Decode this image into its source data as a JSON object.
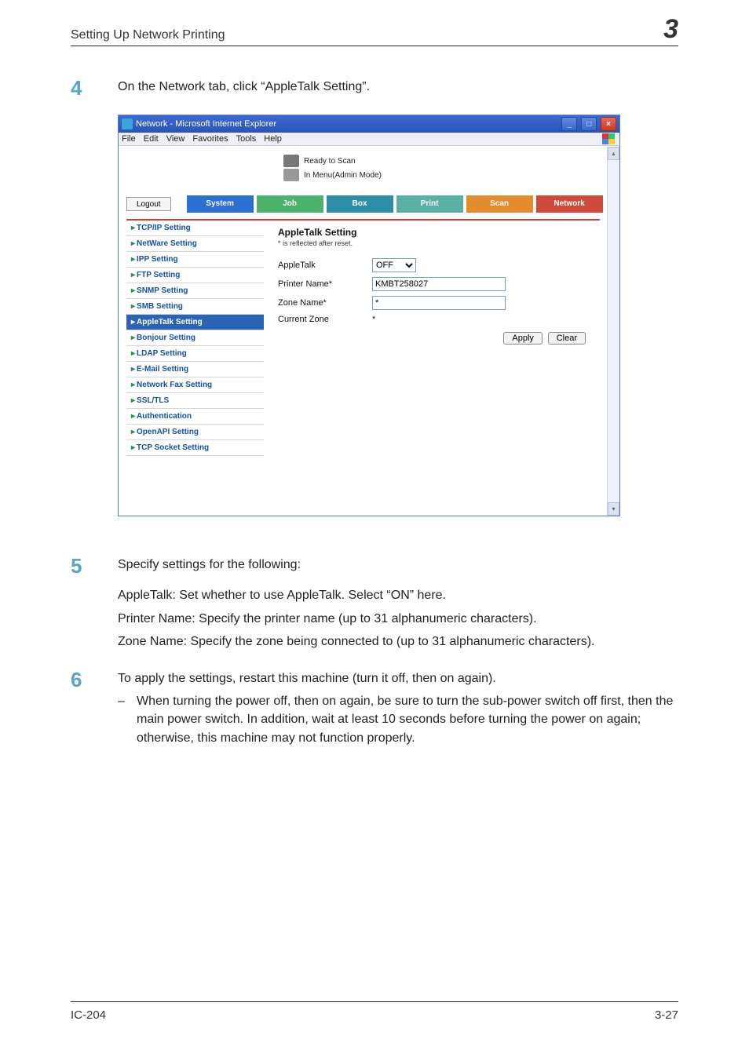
{
  "header": {
    "section_title": "Setting Up Network Printing",
    "chapter_num": "3"
  },
  "steps": {
    "s4": {
      "num": "4",
      "text": "On the Network tab, click “AppleTalk Setting”."
    },
    "s5": {
      "num": "5",
      "lead": "Specify settings for the following:",
      "p1": "AppleTalk: Set whether to use AppleTalk. Select “ON” here.",
      "p2": "Printer Name: Specify the printer name (up to 31 alphanumeric characters).",
      "p3": "Zone Name: Specify the zone being connected to (up to 31 alphanumeric characters)."
    },
    "s6": {
      "num": "6",
      "lead": "To apply the settings, restart this machine (turn it off, then on again).",
      "bullet1": "When turning the power off, then on again, be sure to turn the sub-power switch off first, then the main power switch. In addition, wait at least 10 seconds before turning the power on again; otherwise, this machine may not function properly."
    }
  },
  "window": {
    "title": "Network - Microsoft Internet Explorer",
    "menus": [
      "File",
      "Edit",
      "View",
      "Favorites",
      "Tools",
      "Help"
    ],
    "status1": "Ready to Scan",
    "status2": "In Menu(Admin Mode)",
    "logout": "Logout",
    "tabs": {
      "system": "System",
      "job": "Job",
      "box": "Box",
      "print": "Print",
      "scan": "Scan",
      "network": "Network"
    },
    "sidemenu": [
      "TCP/IP Setting",
      "NetWare Setting",
      "IPP Setting",
      "FTP Setting",
      "SNMP Setting",
      "SMB Setting",
      "AppleTalk Setting",
      "Bonjour Setting",
      "LDAP Setting",
      "E-Mail Setting",
      "Network Fax Setting",
      "SSL/TLS",
      "Authentication",
      "OpenAPI Setting",
      "TCP Socket Setting"
    ],
    "main": {
      "heading": "AppleTalk Setting",
      "note": "* is reflected after reset.",
      "row_appletalk": "AppleTalk",
      "row_appletalk_value": "OFF",
      "row_printer": "Printer Name*",
      "row_printer_value": "KMBT258027",
      "row_zone": "Zone Name*",
      "row_zone_value": "*",
      "row_current": "Current Zone",
      "row_current_value": "*",
      "btn_apply": "Apply",
      "btn_clear": "Clear"
    }
  },
  "footer": {
    "left": "IC-204",
    "right": "3-27"
  }
}
